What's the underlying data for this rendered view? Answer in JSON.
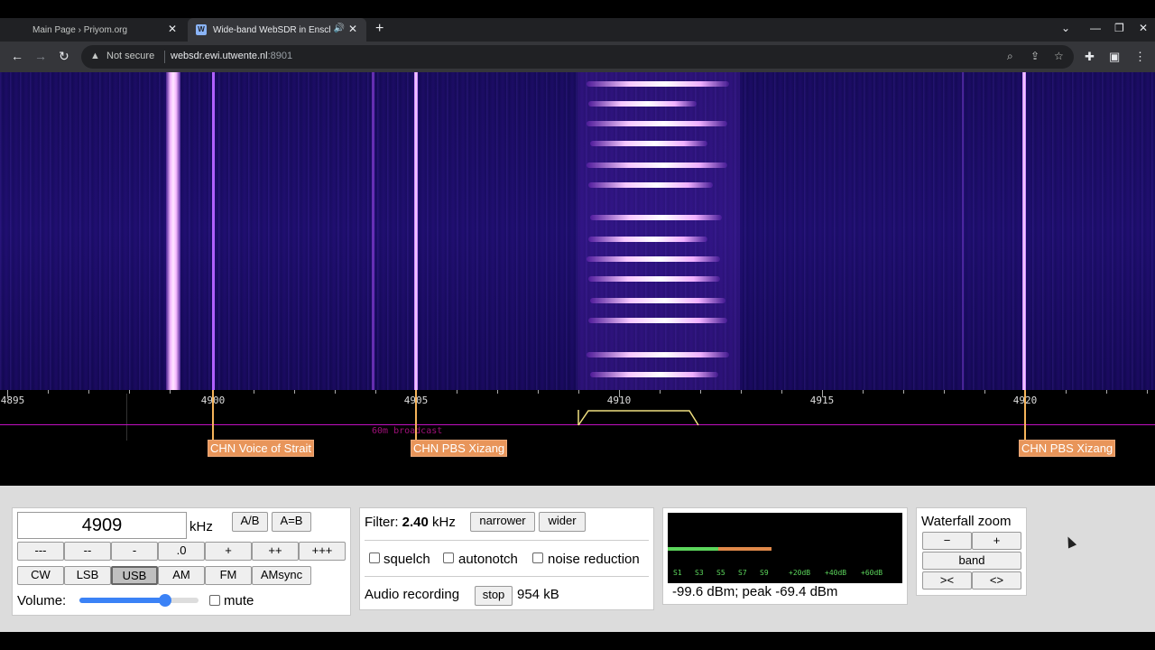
{
  "browser": {
    "tabs": [
      {
        "title": "Main Page › Priyom.org",
        "active": false
      },
      {
        "title": "Wide-band WebSDR in Ensch",
        "active": true
      }
    ],
    "new_tab": "+",
    "address": {
      "security": "Not secure",
      "host": "websdr.ewi.utwente.nl",
      "port": ":8901"
    }
  },
  "scale": {
    "tick_labels": [
      "4895",
      "4900",
      "4905",
      "4910",
      "4915",
      "4920"
    ],
    "band_name": "60m broadcast",
    "stations": [
      {
        "label": "CHN Voice of Strait"
      },
      {
        "label": "CHN PBS Xizang"
      },
      {
        "label": "CHN PBS Xizang"
      }
    ]
  },
  "tuning": {
    "frequency": "4909",
    "unit": "kHz",
    "ab_button": "A/B",
    "aeqb_button": "A=B",
    "step_buttons": [
      "---",
      "--",
      "-",
      ".0",
      "+",
      "++",
      "+++"
    ],
    "modes": [
      "CW",
      "LSB",
      "USB",
      "AM",
      "FM",
      "AMsync"
    ],
    "selected_mode": "USB",
    "volume_label": "Volume:",
    "volume_level": 0.72,
    "mute_label": "mute"
  },
  "filter": {
    "label": "Filter:",
    "width": "2.40",
    "unit": "kHz",
    "narrower": "narrower",
    "wider": "wider",
    "squelch": "squelch",
    "autonotch": "autonotch",
    "noise_reduction": "noise reduction",
    "recording_label": "Audio recording",
    "stop": "stop",
    "size": "954 kB"
  },
  "smeter": {
    "scale_labels": [
      "S1",
      "S3",
      "S5",
      "S7",
      "S9",
      "+20dB",
      "+40dB",
      "+60dB"
    ],
    "readout": "-99.6 dBm; peak  -69.4 dBm"
  },
  "zoom": {
    "title": "Waterfall zoom",
    "minus": "−",
    "plus": "+",
    "band": "band",
    "narrow": "><",
    "wide": "<>"
  },
  "colors": {
    "station_bg": "#e8955a",
    "waterfall_bg": "#140a55",
    "accent": "#3b82f6"
  }
}
